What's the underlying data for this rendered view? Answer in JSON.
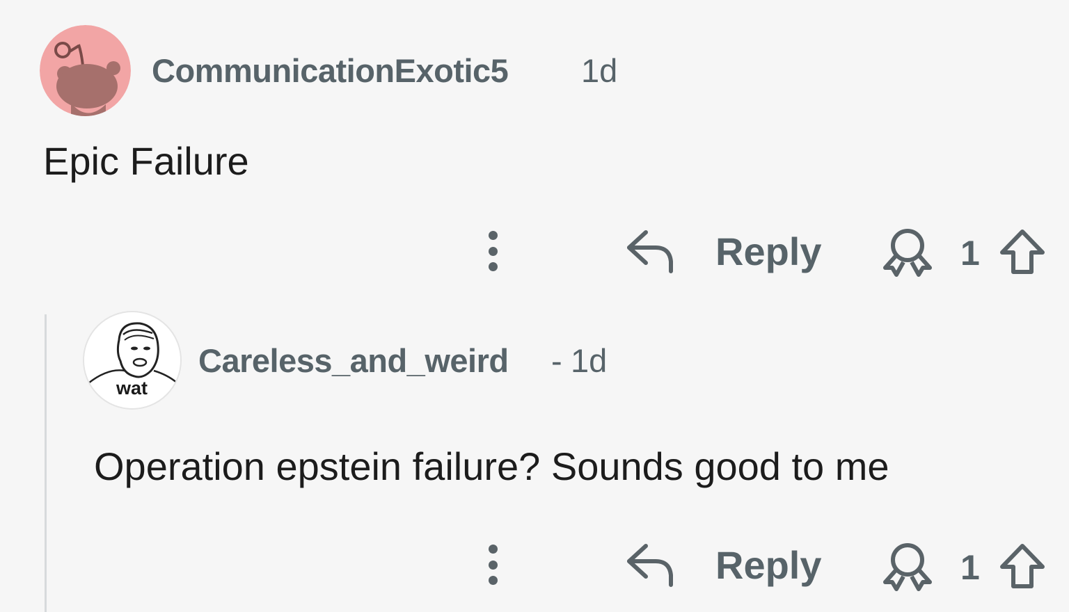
{
  "comments": [
    {
      "username": "CommunicationExotic5",
      "age": "1d",
      "body": "Epic Failure",
      "reply_label": "Reply",
      "vote_count": "1",
      "avatar_bg": "#f2a5a5"
    },
    {
      "username": "Careless_and_weird",
      "separator": "-",
      "age": "1d",
      "body": "Operation epstein failure? Sounds good to me",
      "reply_label": "Reply",
      "vote_count": "1",
      "avatar_caption": "wat",
      "avatar_bg": "#ffffff"
    }
  ],
  "icons": [
    "snoo-avatar-icon",
    "wat-avatar-icon",
    "more-options-icon",
    "reply-arrow-icon",
    "award-icon",
    "upvote-icon"
  ],
  "colors": {
    "background": "#f6f6f6",
    "meta_text": "#576369",
    "body_text": "#1c1c1c",
    "thread_line": "#d7dadc"
  }
}
